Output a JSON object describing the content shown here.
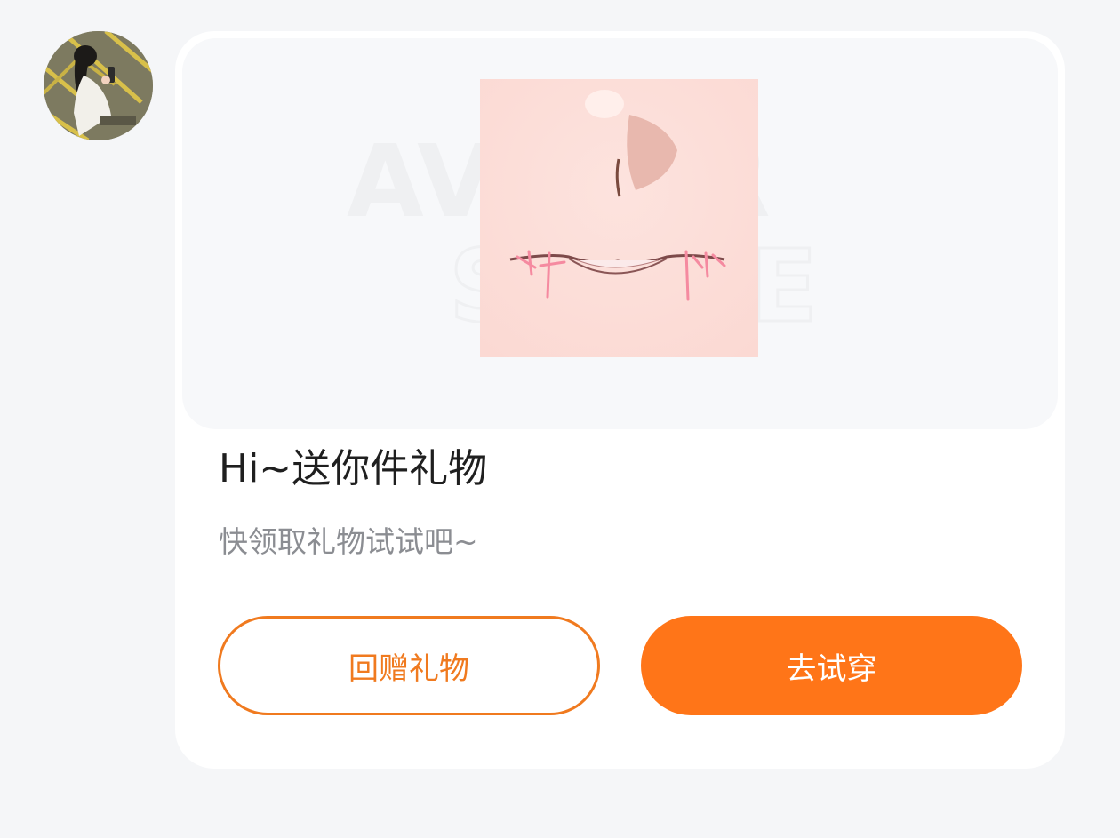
{
  "message": {
    "title": "Hi~送你件礼物",
    "subtitle": "快领取礼物试试吧~"
  },
  "preview": {
    "watermark_line1": "AVATAR",
    "watermark_line2": "STORE"
  },
  "actions": {
    "return_gift_label": "回赠礼物",
    "try_on_label": "去试穿"
  },
  "colors": {
    "accent": "#ff7518",
    "outline": "#f07a1f",
    "background": "#f5f6f8",
    "card": "#ffffff",
    "skin": "#fde1dc"
  }
}
